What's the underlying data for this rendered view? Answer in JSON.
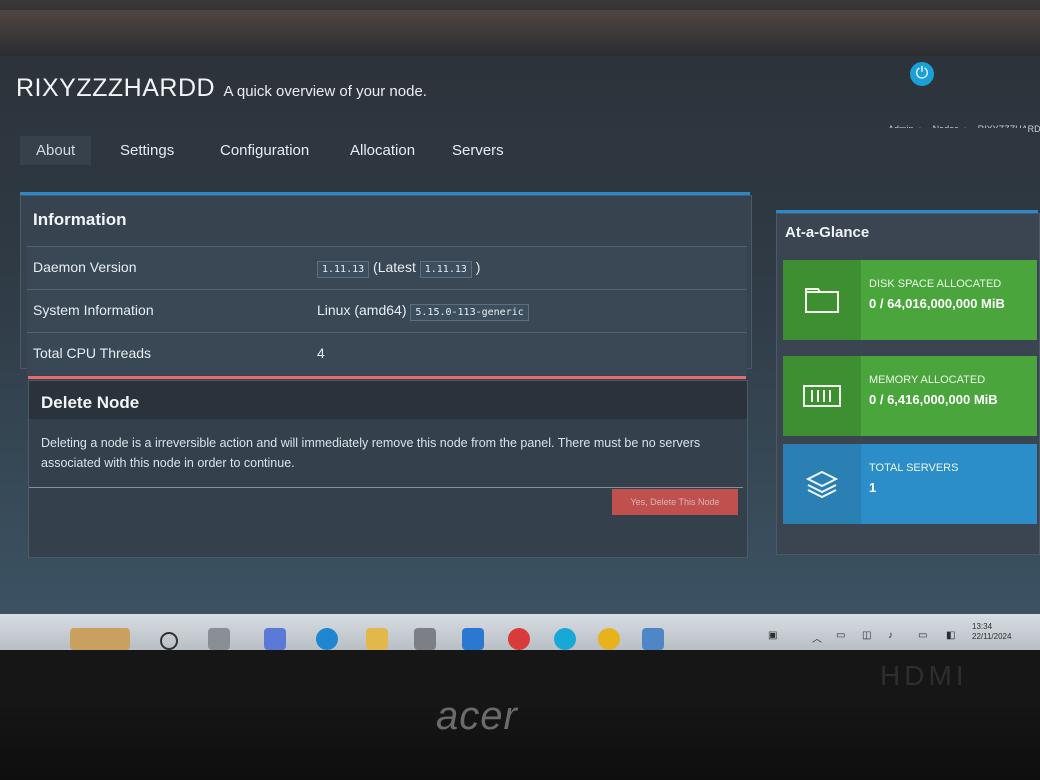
{
  "header": {
    "node_name": "RIXYZZZHARDD",
    "subtitle": "A quick overview of your node."
  },
  "breadcrumb": [
    "Admin",
    "Nodes",
    "RIXYZZZHARD"
  ],
  "tabs": [
    "About",
    "Settings",
    "Configuration",
    "Allocation",
    "Servers"
  ],
  "information": {
    "title": "Information",
    "rows": [
      {
        "label": "Daemon Version",
        "version": "1.11.13",
        "latest_prefix": "(Latest",
        "latest": "1.11.13",
        "latest_suffix": ")"
      },
      {
        "label": "System Information",
        "os": "Linux (amd64)",
        "kernel": "5.15.0-113-generic"
      },
      {
        "label": "Total CPU Threads",
        "value": "4"
      }
    ]
  },
  "delete_node": {
    "title": "Delete Node",
    "description": "Deleting a node is a irreversible action and will immediately remove this node from the panel. There must be no servers associated with this node in order to continue.",
    "button_label": "Yes, Delete This Node"
  },
  "at_a_glance": {
    "title": "At-a-Glance",
    "stats": [
      {
        "label": "DISK SPACE ALLOCATED",
        "value": "0 / 64,016,000,000 MiB",
        "icon": "folder-icon"
      },
      {
        "label": "MEMORY ALLOCATED",
        "value": "0 / 6,416,000,000 MiB",
        "icon": "memory-icon"
      },
      {
        "label": "TOTAL SERVERS",
        "value": "1",
        "icon": "layers-icon"
      }
    ]
  },
  "taskbar": {
    "time": "13:34",
    "date": "22/11/2024"
  },
  "colors": {
    "accent_blue": "#2c88c7",
    "danger_red": "#d9534f",
    "success_green": "#4aa53c",
    "info_blue": "#2b8ec9"
  }
}
